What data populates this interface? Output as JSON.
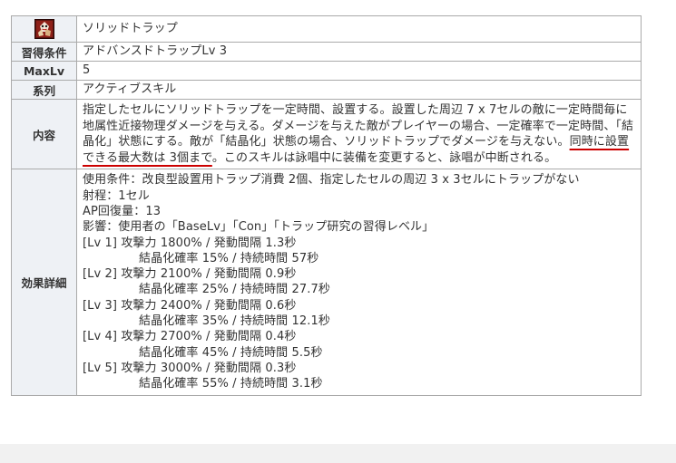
{
  "skill": {
    "icon": "trap-crystal-icon",
    "name": "ソリッドトラップ",
    "rows": {
      "prereq": {
        "label": "習得条件",
        "value": "アドバンスドトラップLv 3"
      },
      "maxlv": {
        "label": "MaxLv",
        "value": "5"
      },
      "type": {
        "label": "系列",
        "value": "アクティブスキル"
      }
    },
    "description": {
      "label": "内容",
      "text_before": "指定したセルにソリッドトラップを一定時間、設置する。設置した周辺 7 x 7セルの敵に一定時間毎に地属性近接物理ダメージを与える。ダメージを与えた敵がプレイヤーの場合、一定確率で一定時間、「結晶化」状態にする。敵が「結晶化」状態の場合、ソリッドトラップでダメージを与えない。",
      "text_highlight": "同時に設置できる最大数は 3個まで",
      "text_after": "。このスキルは詠唱中に装備を変更すると、詠唱が中断される。"
    },
    "details": {
      "label": "効果詳細",
      "lines": [
        "使用条件：改良型設置用トラップ消費 2個、指定したセルの周辺 3 x 3セルにトラップがない",
        "射程：1セル",
        "AP回復量：13",
        "影響：使用者の「BaseLv」「Con」「トラップ研究の習得レベル」"
      ],
      "levels": [
        {
          "head": "[Lv 1] 攻撃力 1800% / 発動間隔 1.3秒",
          "sub": "結晶化確率 15% / 持続時間 57秒"
        },
        {
          "head": "[Lv 2] 攻撃力 2100% / 発動間隔 0.9秒",
          "sub": "結晶化確率 25% / 持続時間 27.7秒"
        },
        {
          "head": "[Lv 3] 攻撃力 2400% / 発動間隔 0.6秒",
          "sub": "結晶化確率 35% / 持続時間 12.1秒"
        },
        {
          "head": "[Lv 4] 攻撃力 2700% / 発動間隔 0.4秒",
          "sub": "結晶化確率 45% / 持続時間 5.5秒"
        },
        {
          "head": "[Lv 5] 攻撃力 3000% / 発動間隔 0.3秒",
          "sub": "結晶化確率 55% / 持続時間 3.1秒"
        }
      ]
    },
    "colors": {
      "header_bg": "#eef1f5",
      "border": "#aaaaaa",
      "highlight_underline": "#cc0000"
    }
  }
}
